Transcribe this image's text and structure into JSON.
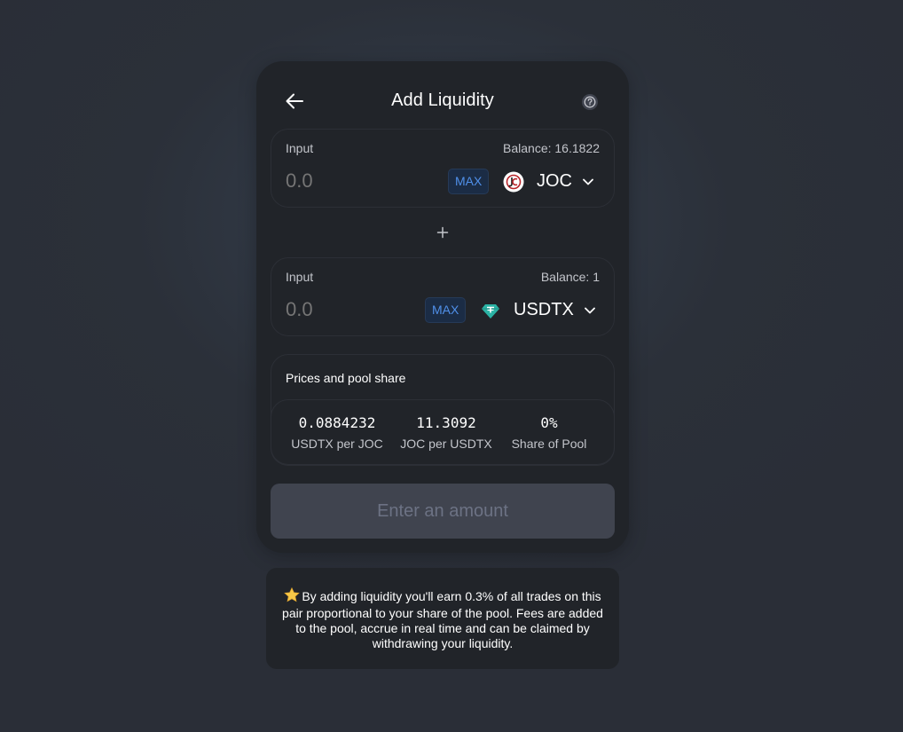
{
  "header": {
    "title": "Add Liquidity"
  },
  "icons": {
    "back": "arrow-left-icon",
    "help": "question-circle-icon",
    "plus": "plus-icon",
    "chevron": "chevron-down-icon",
    "star": "star-icon"
  },
  "input_a": {
    "label": "Input",
    "balance": "Balance: 16.1822",
    "placeholder": "0.0",
    "max_label": "MAX",
    "token": "JOC"
  },
  "input_b": {
    "label": "Input",
    "balance": "Balance: 1",
    "placeholder": "0.0",
    "max_label": "MAX",
    "token": "USDTX"
  },
  "prices": {
    "title": "Prices and pool share",
    "stats": [
      {
        "value": "0.0884232",
        "label": "USDTX per JOC"
      },
      {
        "value": "11.3092",
        "label": "JOC per USDTX"
      },
      {
        "value": "0%",
        "label": "Share of Pool"
      }
    ]
  },
  "cta": {
    "label": "Enter an amount"
  },
  "note": {
    "text": "By adding liquidity you'll earn 0.3% of all trades on this pair proportional to your share of the pool. Fees are added to the pool, accrue in real time and can be claimed by withdrawing your liquidity."
  },
  "colors": {
    "background": "#2b3039",
    "card": "#212429",
    "accent": "#5090ea",
    "disabled_button": "#40444f",
    "muted_text": "#6c7284",
    "usdtx_icon": "#2bb3a5",
    "joc_icon": "#b8262b"
  }
}
